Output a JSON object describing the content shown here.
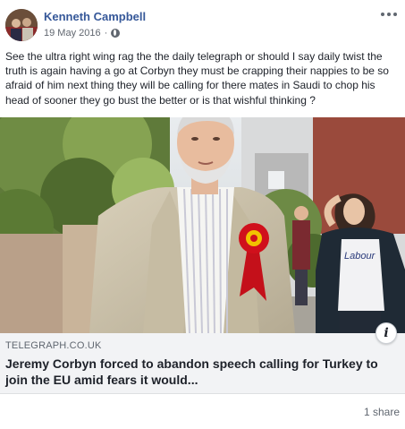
{
  "post": {
    "author": "Kenneth Campbell",
    "date": "19 May 2016",
    "separator": "·",
    "privacy_icon": "globe-icon",
    "more_icon": "more-options-icon",
    "text": "See the ultra right wing rag the the daily telegraph or should I say daily twist the truth is again having a go at Corbyn they must be crapping their nappies to be so afraid of him next thing they will be calling for there mates in Saudi to chop his head of sooner they go bust the better or is that wishful thinking ?"
  },
  "link": {
    "domain": "TELEGRAPH.CO.UK",
    "title": "Jeremy Corbyn forced to abandon speech calling for Turkey to join the EU amid fears it would...",
    "info_icon_label": "i"
  },
  "image": {
    "shirt_text": "Labour"
  },
  "footer": {
    "shares": "1 share"
  },
  "colors": {
    "author": "#365899",
    "link_bg": "#f2f3f5",
    "rosette_red": "#d0101c",
    "rosette_gold": "#f2c200"
  }
}
